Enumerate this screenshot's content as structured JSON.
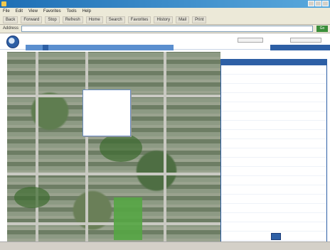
{
  "window": {
    "title": ""
  },
  "menubar": {
    "items": [
      "File",
      "Edit",
      "View",
      "Favorites",
      "Tools",
      "Help"
    ]
  },
  "toolbar": {
    "buttons": [
      "Back",
      "Forward",
      "Stop",
      "Refresh",
      "Home",
      "Search",
      "Favorites",
      "History",
      "Mail",
      "Print"
    ]
  },
  "address": {
    "label": "Address",
    "value": "",
    "go_label": "Go"
  },
  "site": {
    "title": "",
    "search_placeholder": "",
    "select_value": "",
    "nav": [
      "",
      "",
      "",
      "",
      ""
    ],
    "tool_label": ""
  },
  "dropdown": {
    "items": [
      "",
      "",
      "",
      "",
      "",
      "",
      ""
    ]
  },
  "panel": {
    "header": "",
    "rows": [
      {
        "k": "",
        "v": ""
      },
      {
        "k": "",
        "v": ""
      },
      {
        "k": "",
        "v": ""
      },
      {
        "k": "",
        "v": ""
      },
      {
        "k": "",
        "v": ""
      },
      {
        "k": "",
        "v": ""
      },
      {
        "k": "",
        "v": ""
      },
      {
        "k": "",
        "v": ""
      },
      {
        "k": "",
        "v": ""
      },
      {
        "k": "",
        "v": ""
      },
      {
        "k": "",
        "v": ""
      },
      {
        "k": "",
        "v": ""
      },
      {
        "k": "",
        "v": ""
      },
      {
        "k": "",
        "v": ""
      },
      {
        "k": "",
        "v": ""
      },
      {
        "k": "",
        "v": ""
      },
      {
        "k": "",
        "v": ""
      },
      {
        "k": "",
        "v": ""
      },
      {
        "k": "",
        "v": ""
      },
      {
        "k": "",
        "v": ""
      }
    ]
  },
  "status": {
    "text": ""
  },
  "colors": {
    "accent": "#2d5fa5",
    "nav": "#5b8fcf",
    "highlight": "#d8ef6b"
  }
}
